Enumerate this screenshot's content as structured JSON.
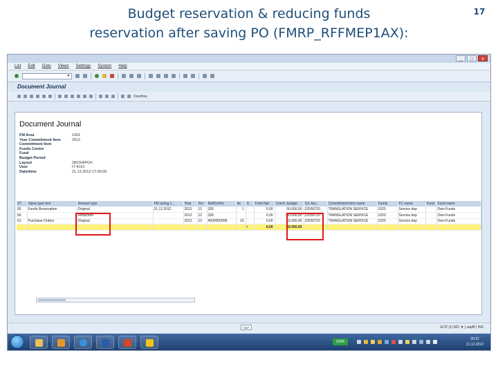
{
  "slide": {
    "title_line1": "Budget reservation & reducing funds",
    "title_line2": "reservation after saving PO (FMRP_RFFMEP1AX):",
    "page_number": "17"
  },
  "window": {
    "controls": [
      "_",
      "□",
      "x"
    ]
  },
  "menubar": {
    "items": [
      "List",
      "Edit",
      "Goto",
      "Views",
      "Settings",
      "System",
      "Help"
    ]
  },
  "app": {
    "title": "Document Journal",
    "toolbar_text": "Overflow"
  },
  "report": {
    "title": "Document Journal",
    "header_fields": [
      {
        "label": "FM Area",
        "value": "1001"
      },
      {
        "label": "Year Commitment Item",
        "value": "2012"
      },
      {
        "label": "Commitment Item",
        "value": ""
      },
      {
        "label": "Funds Centre",
        "value": ""
      },
      {
        "label": "Fund",
        "value": ""
      },
      {
        "label": "Budget Period",
        "value": ""
      },
      {
        "label": "Layout",
        "value": "1BOXAPOX"
      },
      {
        "label": "User",
        "value": "IT-4191"
      },
      {
        "label": "Date/time",
        "value": "21.12.2012 17:00:00"
      }
    ]
  },
  "table": {
    "columns": [
      "V?",
      "Value type text",
      "Amount type",
      "FM acting c...",
      "Year",
      "Per",
      "RefDocNo",
      "Ite",
      "S",
      "Fvmt Rpt",
      "Cmmt. budget",
      "Cd. Acc.",
      "Commitment item name",
      "Funds",
      "FC name",
      "Fund",
      "Fund name"
    ],
    "rows": [
      [
        "55",
        "Funds Reservation",
        "Original",
        "21.12.2012",
        "2012",
        "12",
        "326",
        "1",
        "",
        "0,00",
        "50.000,00",
        "22550720",
        "TRANSLATION SERVICE",
        "1020",
        "Service dep",
        "",
        "Own Funds"
      ],
      [
        "50",
        "",
        "Reduction",
        "",
        "2012",
        "12",
        "326",
        "",
        "",
        "0,00",
        "-50.000,00",
        "22550720",
        "TRANSLATION SERVICE",
        "1020",
        "Service dep",
        "",
        "Own Funds"
      ],
      [
        "51",
        "Purchase Orders",
        "Original",
        "",
        "2012",
        "12",
        "4500000008",
        "10",
        "",
        "0,00",
        "50.000,00",
        "22550720",
        "TRANSLATION SERVICE",
        "1020",
        "Service dep",
        "",
        "Own Funds"
      ]
    ],
    "total": {
      "marker": "•",
      "fvmt_rpt": "0,00",
      "cmmt_budget": "50.000,00"
    }
  },
  "status": {
    "system_info": "ECP (1) 801 ▼ | sapflf | INS"
  },
  "taskbar": {
    "language": "100%",
    "clock_time": "20:21",
    "clock_date": "21.12.2012"
  },
  "colors": {
    "title_text": "#1f4e79",
    "highlight_box": "#e01818",
    "total_row": "#fff27a",
    "table_header": "#c7d6e7"
  }
}
